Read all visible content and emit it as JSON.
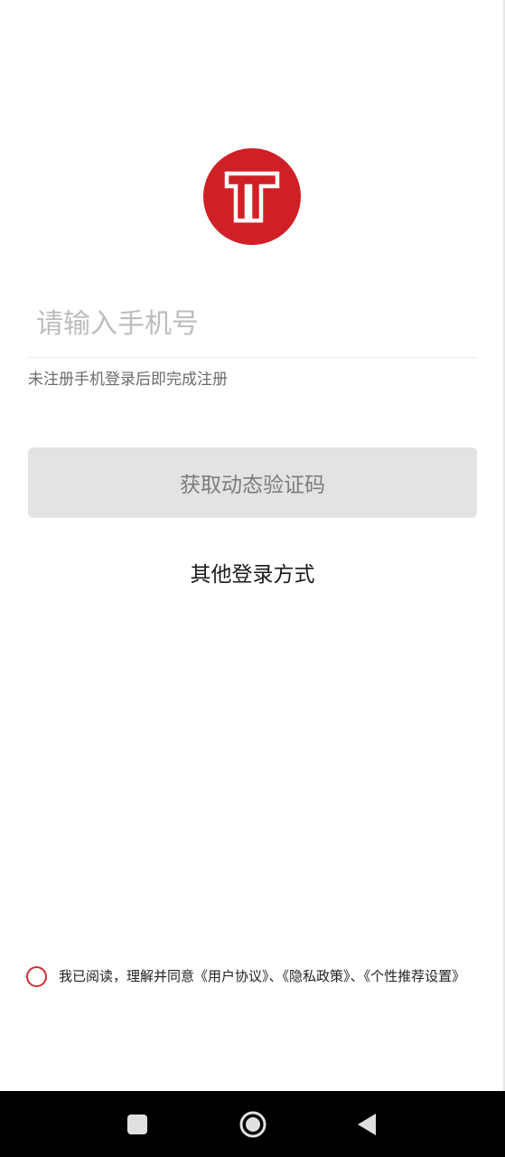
{
  "login": {
    "phone_placeholder": "请输入手机号",
    "hint": "未注册手机登录后即完成注册",
    "get_code_label": "获取动态验证码",
    "other_login_label": "其他登录方式"
  },
  "agreement": {
    "prefix": "我已阅读，理解并同意",
    "user_agreement": "《用户协议》",
    "sep1": "、",
    "privacy_policy": "《隐私政策》",
    "sep2": "、",
    "personalized_settings": "《个性推荐设置》"
  },
  "icons": {
    "logo": "brand-logo-icon",
    "nav_recent": "square-icon",
    "nav_home": "circle-home-icon",
    "nav_back": "triangle-back-icon"
  },
  "colors": {
    "brand_red": "#d02027",
    "button_disabled_bg": "#e3e3e3",
    "button_disabled_text": "#7c7c7c",
    "radio_border": "#cc2f33"
  }
}
